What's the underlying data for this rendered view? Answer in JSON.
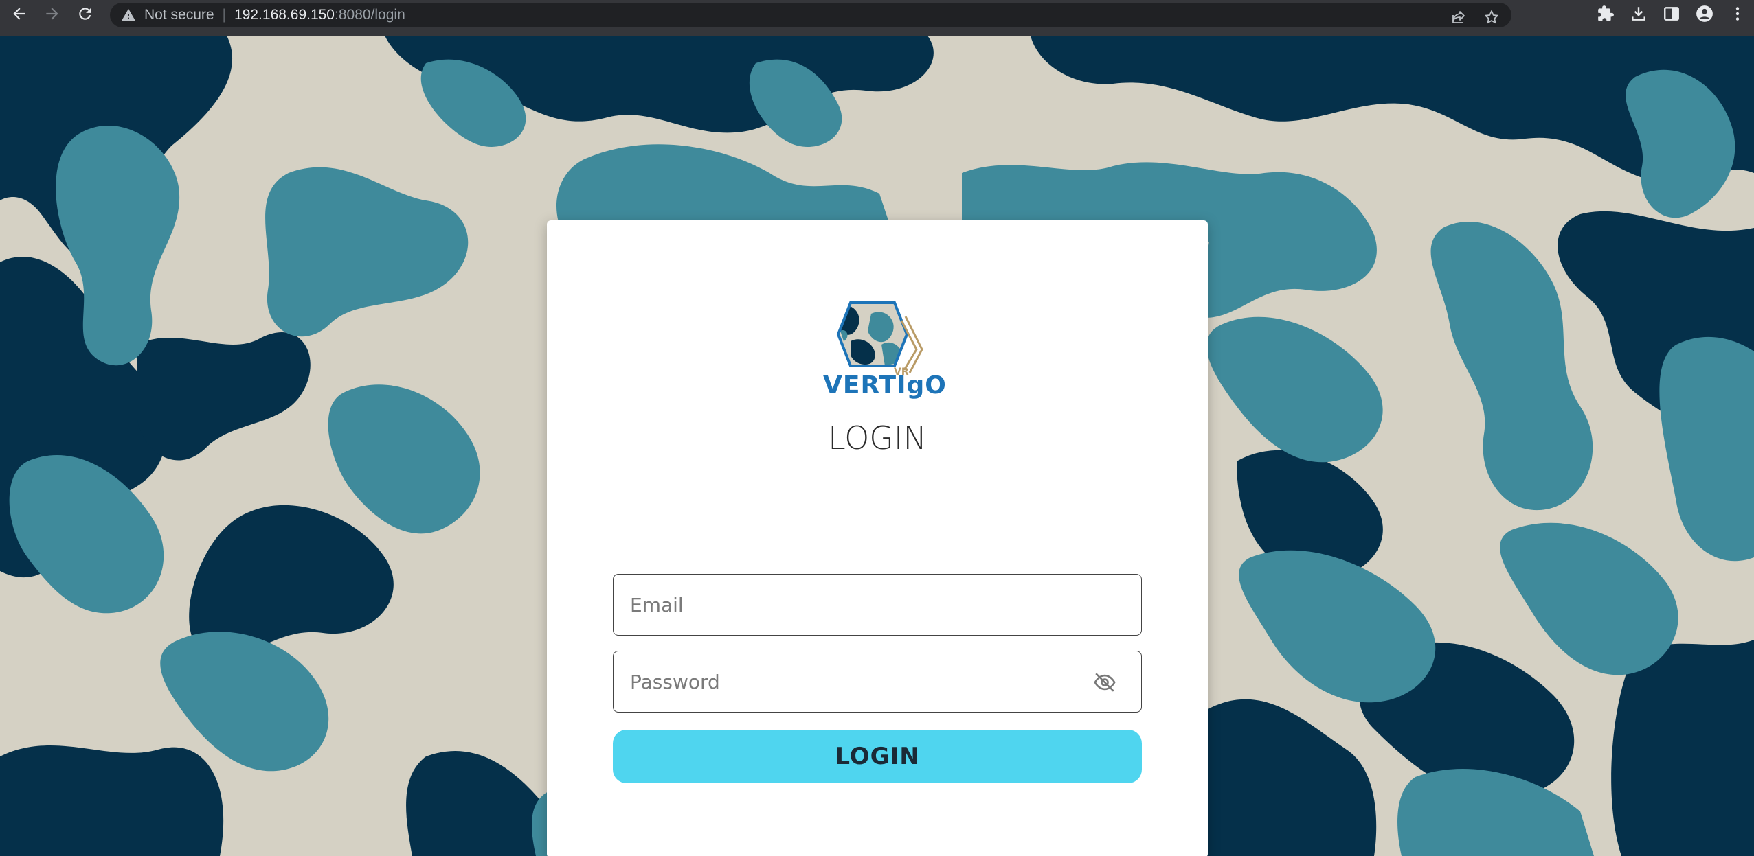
{
  "browser": {
    "security_label": "Not secure",
    "url_host": "192.168.69.150",
    "url_rest": ":8080/login",
    "icons": [
      "back-icon",
      "forward-icon",
      "reload-icon",
      "warning-icon",
      "share-icon",
      "bookmark-star-icon",
      "extensions-icon",
      "download-icon",
      "side-panel-icon",
      "profile-icon",
      "menu-icon"
    ]
  },
  "colors": {
    "camo_light": "#d5d1c4",
    "camo_teal": "#3f8a9b",
    "camo_navy": "#05304a",
    "button": "#4fd5ef",
    "logo_blue": "#1d74b8",
    "logo_gold": "#b99b66"
  },
  "login": {
    "brand": "VERTIgO",
    "brand_badge": "VR",
    "title": "LOGIN",
    "email_placeholder": "Email",
    "password_placeholder": "Password",
    "button_label": "LOGIN"
  }
}
